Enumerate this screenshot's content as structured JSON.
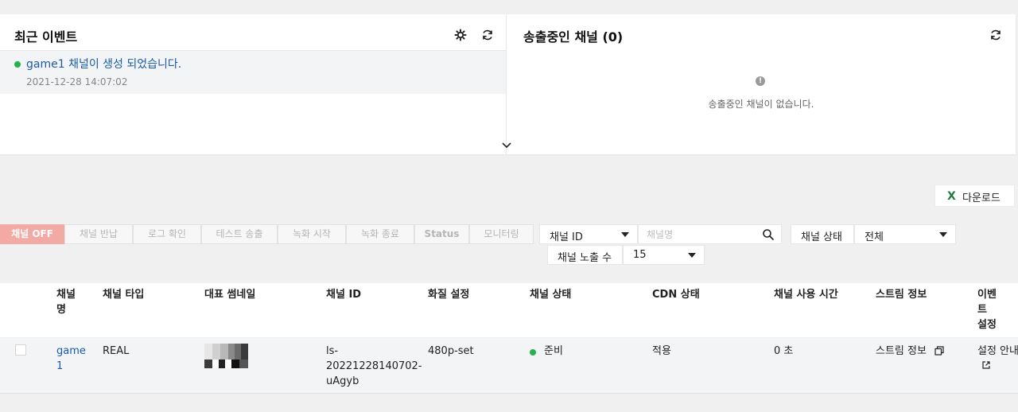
{
  "events_panel": {
    "title": "최근 이벤트",
    "icons": {
      "settings": "gear-icon",
      "refresh": "refresh-icon"
    },
    "items": [
      {
        "text": "game1 채널이 생성 되었습니다.",
        "time": "2021-12-28 14:07:02",
        "status_color": "#22b34c"
      }
    ]
  },
  "streaming_panel": {
    "title": "송출중인 채널 (0)",
    "empty_icon_glyph": "!",
    "empty_message": "송출중인 채널이 없습니다."
  },
  "download_button": {
    "icon": "excel-icon",
    "icon_glyph": "X",
    "label": "다운로드"
  },
  "toolbar": {
    "buttons": [
      "채널 OFF",
      "채널 반납",
      "로그 확인",
      "테스트 송출",
      "녹화 시작",
      "녹화 종료",
      "Status",
      "모니터링"
    ],
    "search_field": {
      "selected": "채널 ID",
      "placeholder": "채널명"
    },
    "status_filter": {
      "label": "채널 상태",
      "selected": "전체"
    },
    "page_size": {
      "label": "채널 노출 수",
      "selected": "15"
    }
  },
  "table": {
    "headers": [
      "채널\n명",
      "채널 타입",
      "대표 썸네일",
      "채널 ID",
      "화질 설정",
      "채널 상태",
      "CDN 상태",
      "채널 사용 시간",
      "스트림 정보",
      "이벤\n트\n설정"
    ],
    "rows": [
      {
        "name": "game\n1",
        "type": "REAL",
        "channel_id": "ls-\n20221228140702-\nuAgyb",
        "quality": "480p-set",
        "status": "준비",
        "status_color": "#22b34c",
        "cdn": "적용",
        "usage_time": "0 초",
        "stream_info": "스트림 정보",
        "event_setting": "설정 안내"
      }
    ]
  },
  "colors": {
    "accent_link": "#1a5aa6",
    "primary_button": "#f4aaa4",
    "ok_green": "#22b34c"
  }
}
